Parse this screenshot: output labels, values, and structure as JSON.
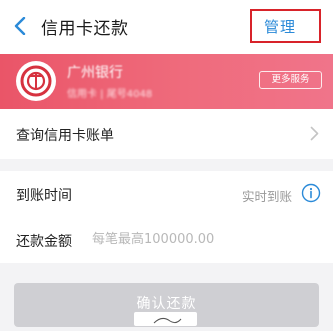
{
  "header": {
    "title": "信用卡还款",
    "manage_label": "管理",
    "back_icon": "chevron-left-icon",
    "highlight_color": "#d8232a",
    "link_color": "#2b8ad8"
  },
  "card": {
    "bank_name": "广州银行",
    "card_number": "信用卡 | 尾号4048",
    "more_services_label": "更多服务",
    "logo_icon": "bank-logo-icon",
    "background_color": "#ec5e70"
  },
  "query": {
    "label": "查询信用卡账单",
    "arrow_icon": "chevron-right-icon"
  },
  "form": {
    "arrival": {
      "label": "到账时间",
      "value": "实时到账",
      "info_icon": "info-icon"
    },
    "amount": {
      "label": "还款金额",
      "placeholder": "每笔最高100000.00",
      "value": ""
    }
  },
  "confirm": {
    "label": "确认还款",
    "disabled_color": "#cfcfd3"
  }
}
